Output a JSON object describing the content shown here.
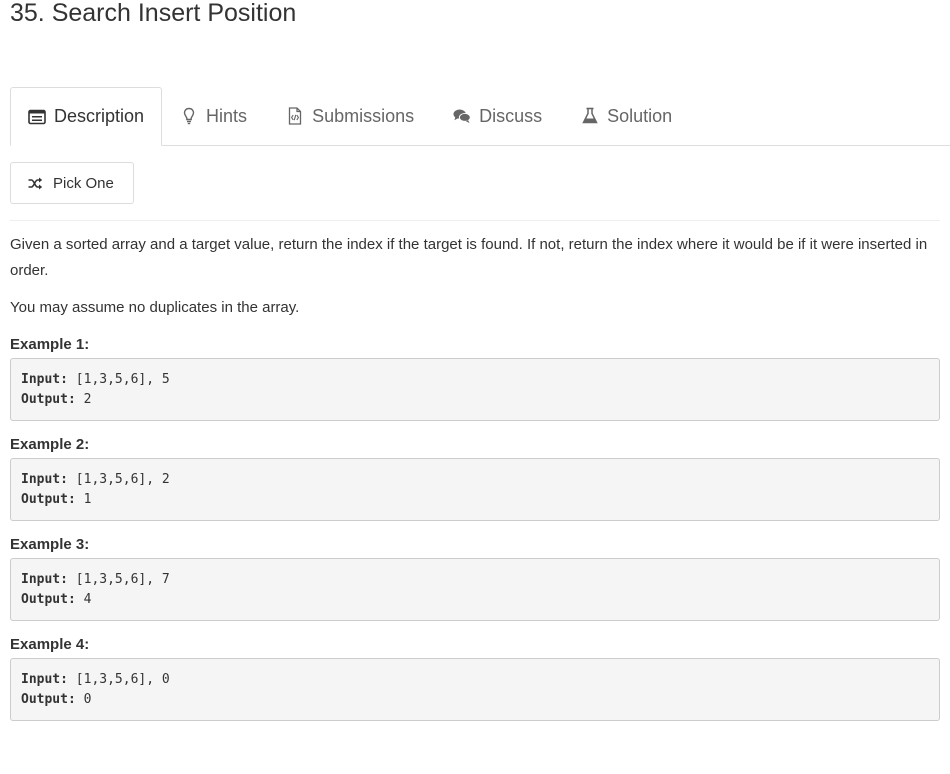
{
  "problem": {
    "title": "35. Search Insert Position"
  },
  "tabs": [
    {
      "label": "Description",
      "icon": "description-icon"
    },
    {
      "label": "Hints",
      "icon": "lightbulb-icon"
    },
    {
      "label": "Submissions",
      "icon": "code-file-icon"
    },
    {
      "label": "Discuss",
      "icon": "chat-bubbles-icon"
    },
    {
      "label": "Solution",
      "icon": "flask-icon"
    }
  ],
  "pick_one": {
    "label": "Pick One",
    "icon": "shuffle-icon"
  },
  "description": {
    "paragraph1": "Given a sorted array and a target value, return the index if the target is found. If not, return the index where it would be if it were inserted in order.",
    "paragraph2": "You may assume no duplicates in the array."
  },
  "examples": [
    {
      "label": "Example 1:",
      "input_label": "Input:",
      "input_value": "[1,3,5,6], 5",
      "output_label": "Output:",
      "output_value": "2"
    },
    {
      "label": "Example 2:",
      "input_label": "Input:",
      "input_value": "[1,3,5,6], 2",
      "output_label": "Output:",
      "output_value": "1"
    },
    {
      "label": "Example 3:",
      "input_label": "Input:",
      "input_value": "[1,3,5,6], 7",
      "output_label": "Output:",
      "output_value": "4"
    },
    {
      "label": "Example 4:",
      "input_label": "Input:",
      "input_value": "[1,3,5,6], 0",
      "output_label": "Output:",
      "output_value": "0"
    }
  ],
  "colors": {
    "text": "#333333",
    "muted_text": "#666666",
    "border": "#dddddd",
    "code_background": "#f5f5f5"
  }
}
